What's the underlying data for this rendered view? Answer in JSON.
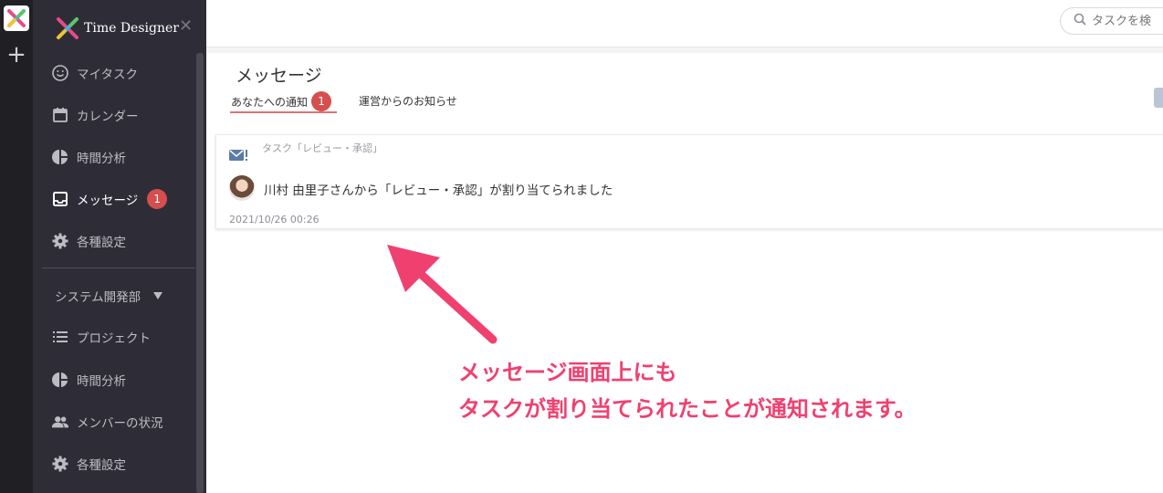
{
  "app": {
    "name": "Time Designer",
    "accent": "#d64e4e"
  },
  "search": {
    "placeholder": "タスクを検"
  },
  "sidebar": {
    "items": [
      {
        "label": "マイタスク",
        "icon": "smile-icon"
      },
      {
        "label": "カレンダー",
        "icon": "calendar-icon"
      },
      {
        "label": "時間分析",
        "icon": "pie-chart-icon"
      },
      {
        "label": "メッセージ",
        "icon": "inbox-icon",
        "badge": "1",
        "active": true
      },
      {
        "label": "各種設定",
        "icon": "gear-icon"
      }
    ],
    "group": {
      "label": "システム開発部",
      "icon": "caret-down-icon"
    },
    "group_items": [
      {
        "label": "プロジェクト",
        "icon": "list-icon"
      },
      {
        "label": "時間分析",
        "icon": "pie-chart-icon"
      },
      {
        "label": "メンバーの状況",
        "icon": "people-icon"
      },
      {
        "label": "各種設定",
        "icon": "gear-icon"
      }
    ]
  },
  "messages": {
    "title": "メッセージ",
    "tabs": [
      {
        "label": "あなたへの通知",
        "badge": "1",
        "active": true
      },
      {
        "label": "運営からのお知らせ"
      }
    ],
    "notifications": [
      {
        "category": "タスク「レビュー・承認」",
        "text": "川村 由里子さんから「レビュー・承認」が割り当てられました",
        "time": "2021/10/26 00:26"
      }
    ]
  },
  "annotation": {
    "line1": "メッセージ画面上にも",
    "line2": "タスクが割り当てられたことが通知されます。",
    "color": "#f0406f"
  }
}
